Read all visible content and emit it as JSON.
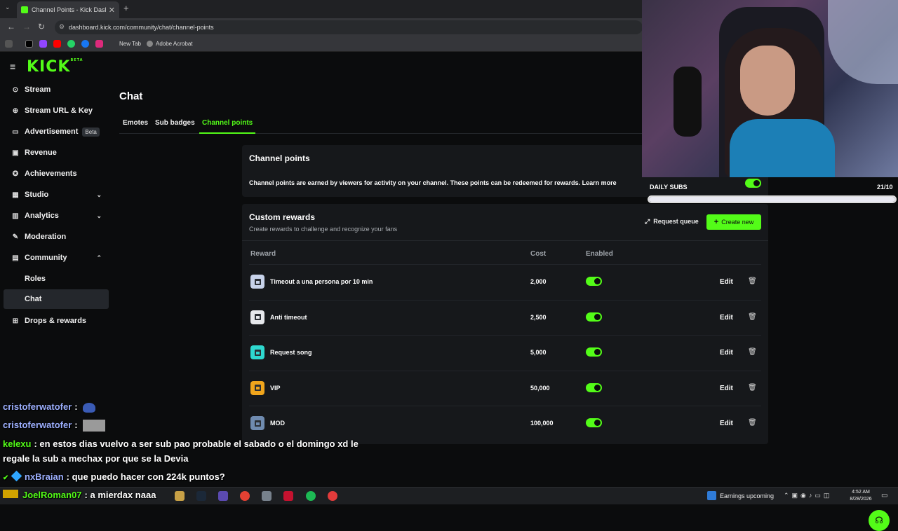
{
  "browser": {
    "tab_title": "Channel Points - Kick Dashboard",
    "tab_close": "✕",
    "new_tab": "+",
    "url": "dashboard.kick.com/community/chat/channel-points",
    "bookmarks": [
      "New Tab",
      "Adobe Acrobat"
    ]
  },
  "brand": {
    "logo": "KICK",
    "logo_tag": "BETA",
    "accent": "#53fc18"
  },
  "sidebar": {
    "items": [
      {
        "label": "Stream",
        "icon": "broadcast-icon"
      },
      {
        "label": "Stream URL & Key",
        "icon": "key-icon"
      },
      {
        "label": "Advertisement",
        "icon": "ad-icon",
        "badge": "Beta"
      },
      {
        "label": "Revenue",
        "icon": "revenue-icon"
      },
      {
        "label": "Achievements",
        "icon": "trophy-icon"
      },
      {
        "label": "Studio",
        "icon": "studio-icon",
        "expanded": false
      },
      {
        "label": "Analytics",
        "icon": "analytics-icon",
        "expanded": false
      },
      {
        "label": "Moderation",
        "icon": "wrench-icon"
      },
      {
        "label": "Community",
        "icon": "community-icon",
        "expanded": true
      },
      {
        "label": "Roles"
      },
      {
        "label": "Chat",
        "active": true
      },
      {
        "label": "Drops & rewards",
        "icon": "gift-icon"
      }
    ]
  },
  "page": {
    "title": "Chat",
    "tabs": [
      {
        "label": "Emotes"
      },
      {
        "label": "Sub badges"
      },
      {
        "label": "Channel points",
        "active": true
      }
    ]
  },
  "channel_points": {
    "title": "Channel points",
    "description": "Channel points are earned by viewers for activity on your channel. These points can be redeemed for rewards. Learn more"
  },
  "custom_rewards": {
    "title": "Custom rewards",
    "subtitle": "Create rewards to challenge and recognize your fans",
    "request_queue": "Request queue",
    "create_new": "Create new",
    "columns": {
      "reward": "Reward",
      "cost": "Cost",
      "enabled": "Enabled"
    },
    "edit_label": "Edit",
    "rows": [
      {
        "name": "Timeout a una persona por 10 min",
        "cost": "2,000",
        "enabled": true,
        "color": "#c7d2ea"
      },
      {
        "name": "Anti timeout",
        "cost": "2,500",
        "enabled": true,
        "color": "#e6e8ec"
      },
      {
        "name": "Request song",
        "cost": "5,000",
        "enabled": true,
        "color": "#2ed8cf"
      },
      {
        "name": "VIP",
        "cost": "50,000",
        "enabled": true,
        "color": "#f0a51c"
      },
      {
        "name": "MOD",
        "cost": "100,000",
        "enabled": true,
        "color": "#6f8bb0"
      }
    ]
  },
  "overlay": {
    "daily_subs_label": "DAILY SUBS",
    "daily_subs_count": "21/10",
    "daily_subs_progress": 1.0
  },
  "chat_overlay": [
    {
      "user": "cristoferwatofer",
      "color": "#9db0ff",
      "text": ":"
    },
    {
      "user": "cristoferwatofer",
      "color": "#9db0ff",
      "text": ":"
    },
    {
      "user": "kelexu",
      "color": "#53fc18",
      "text": ": en estos dias vuelvo a ser sub pao probable el sabado o el domingo xd le",
      "text2": "regale la sub a mechax por que se la Devia"
    },
    {
      "user": "nxBraian",
      "color": "#9db0ff",
      "text": ": que puedo hacer con 224k puntos?"
    },
    {
      "user": "JoelRoman07",
      "color": "#53fc18",
      "text": ": a mierdax naaa"
    }
  ],
  "taskbar": {
    "news": "Earnings upcoming",
    "time": "4:52 AM",
    "date": "8/28/2026"
  }
}
